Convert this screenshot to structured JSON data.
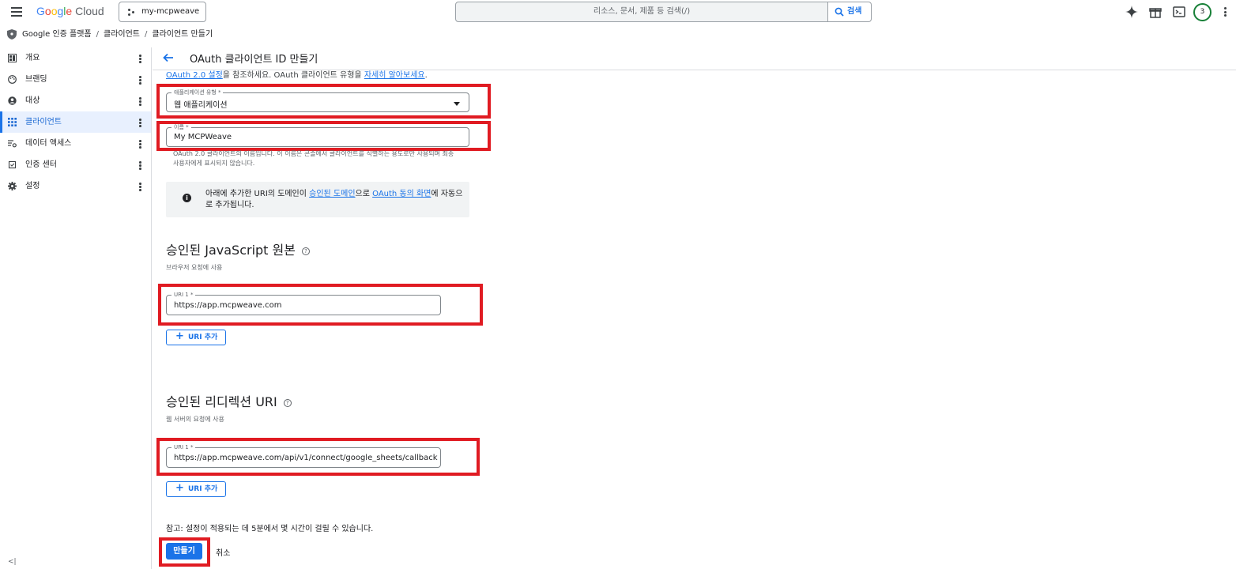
{
  "topbar": {
    "logo": "Google Cloud",
    "project": "my-mcpweave",
    "search_placeholder": "리소스, 문서, 제품 등 검색(/)",
    "search_button": "검색",
    "avatar": "3"
  },
  "breadcrumb": {
    "items": [
      "Google 인증 플랫폼",
      "클라이언트",
      "클라이언트 만들기"
    ]
  },
  "sidebar": {
    "items": [
      {
        "label": "개요",
        "icon": "dashboard-icon"
      },
      {
        "label": "브랜딩",
        "icon": "palette-icon"
      },
      {
        "label": "대상",
        "icon": "account-icon"
      },
      {
        "label": "클라이언트",
        "icon": "grid-icon",
        "active": true
      },
      {
        "label": "데이터 액세스",
        "icon": "data-access-icon"
      },
      {
        "label": "인증 센터",
        "icon": "verified-icon"
      },
      {
        "label": "설정",
        "icon": "gear-icon"
      }
    ],
    "collapse": "<|"
  },
  "page": {
    "title": "OAuth 클라이언트 ID 만들기",
    "top_text_link1": "OAuth 2.0 설정",
    "top_text_mid": "을 참조하세요. OAuth 클라이언트 유형을 ",
    "top_text_link2": "자세히 알아보세요",
    "top_text_end": "."
  },
  "form": {
    "app_type_label": "애플리케이션 유형 *",
    "app_type_value": "웹 애플리케이션",
    "name_label": "이름 *",
    "name_value": "My MCPWeave",
    "name_help": "OAuth 2.0 클라이언트의 이름입니다. 이 이름은 콘솔에서 클라이언트를 식별하는 용도로만 사용되며 최종 사용자에게 표시되지 않습니다.",
    "info_pre": "아래에 추가한 URI의 도메인이 ",
    "info_link1": "승인된 도메인",
    "info_mid": "으로 ",
    "info_link2": "OAuth 동의 화면",
    "info_post": "에 자동으로 추가됩니다.",
    "js_heading": "승인된 JavaScript 원본",
    "js_sub": "브라우저 요청에 사용",
    "js_uri_label": "URI 1 *",
    "js_uri_value": "https://app.mcpweave.com",
    "add_uri": "URI 추가",
    "redirect_heading": "승인된 리디렉션 URI",
    "redirect_sub": "웹 서버의 요청에 사용",
    "redirect_uri_label": "URI 1 *",
    "redirect_uri_value": "https://app.mcpweave.com/api/v1/connect/google_sheets/callback",
    "note": "참고: 설정이 적용되는 데 5분에서 몇 시간이 걸릴 수 있습니다.",
    "create": "만들기",
    "cancel": "취소"
  },
  "colors": {
    "accent": "#1a73e8",
    "highlight": "#e01b22"
  }
}
